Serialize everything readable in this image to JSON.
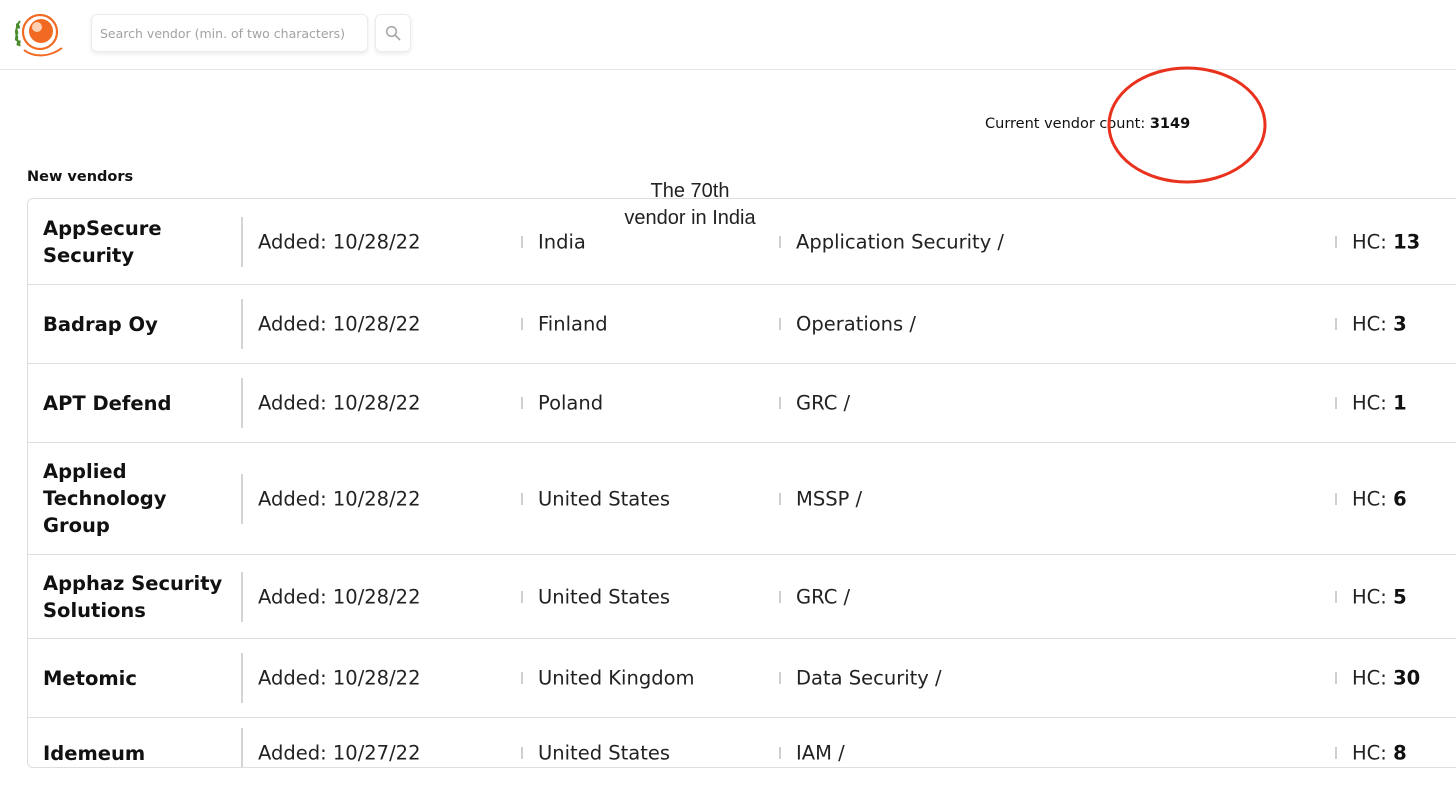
{
  "header": {
    "search_placeholder": "Search vendor (min. of two characters)"
  },
  "summary": {
    "count_label": "Current vendor count:",
    "count_value": "3149"
  },
  "annotation": {
    "line1": "The 70th",
    "line2": "vendor in India",
    "color": "#e8321e"
  },
  "section_title": "New vendors",
  "vendors": [
    {
      "name": "AppSecure Security",
      "added": "Added: 10/28/22",
      "country": "India",
      "category": "Application Security /",
      "hc_label": "HC:",
      "hc": "13"
    },
    {
      "name": "Badrap Oy",
      "added": "Added: 10/28/22",
      "country": "Finland",
      "category": "Operations /",
      "hc_label": "HC:",
      "hc": "3"
    },
    {
      "name": "APT Defend",
      "added": "Added: 10/28/22",
      "country": "Poland",
      "category": "GRC /",
      "hc_label": "HC:",
      "hc": "1"
    },
    {
      "name": "Applied Technology Group",
      "added": "Added: 10/28/22",
      "country": "United States",
      "category": "MSSP /",
      "hc_label": "HC:",
      "hc": "6"
    },
    {
      "name": "Apphaz Security Solutions",
      "added": "Added: 10/28/22",
      "country": "United States",
      "category": "GRC /",
      "hc_label": "HC:",
      "hc": "5"
    },
    {
      "name": "Metomic",
      "added": "Added: 10/28/22",
      "country": "United Kingdom",
      "category": "Data Security /",
      "hc_label": "HC:",
      "hc": "30"
    },
    {
      "name": "Idemeum",
      "added": "Added: 10/27/22",
      "country": "United States",
      "category": "IAM /",
      "hc_label": "HC:",
      "hc": "8"
    }
  ],
  "colors": {
    "logo_orange": "#f26a21",
    "logo_green": "#4a8b2c",
    "border": "#dedede"
  }
}
